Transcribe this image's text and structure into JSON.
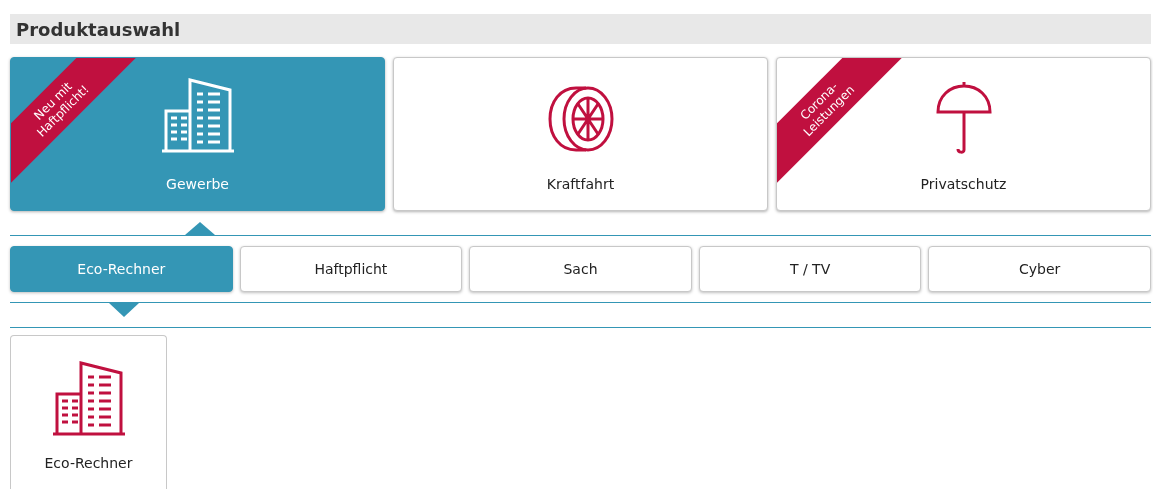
{
  "section_title": "Produktauswahl",
  "products": [
    {
      "label": "Gewerbe",
      "kind": "building",
      "selected": true,
      "ribbon": [
        "Neu mit",
        "Haftpflicht!"
      ]
    },
    {
      "label": "Kraftfahrt",
      "kind": "tire",
      "selected": false
    },
    {
      "label": "Privatschutz",
      "kind": "umbrella",
      "selected": false,
      "ribbon": [
        "Corona-",
        "Leistungen"
      ]
    }
  ],
  "tabs": [
    {
      "label": "Eco-Rechner",
      "selected": true
    },
    {
      "label": "Haftpflicht",
      "selected": false
    },
    {
      "label": "Sach",
      "selected": false
    },
    {
      "label": "T / TV",
      "selected": false
    },
    {
      "label": "Cyber",
      "selected": false
    }
  ],
  "tiles": [
    {
      "label": "Eco-Rechner",
      "kind": "building"
    }
  ]
}
